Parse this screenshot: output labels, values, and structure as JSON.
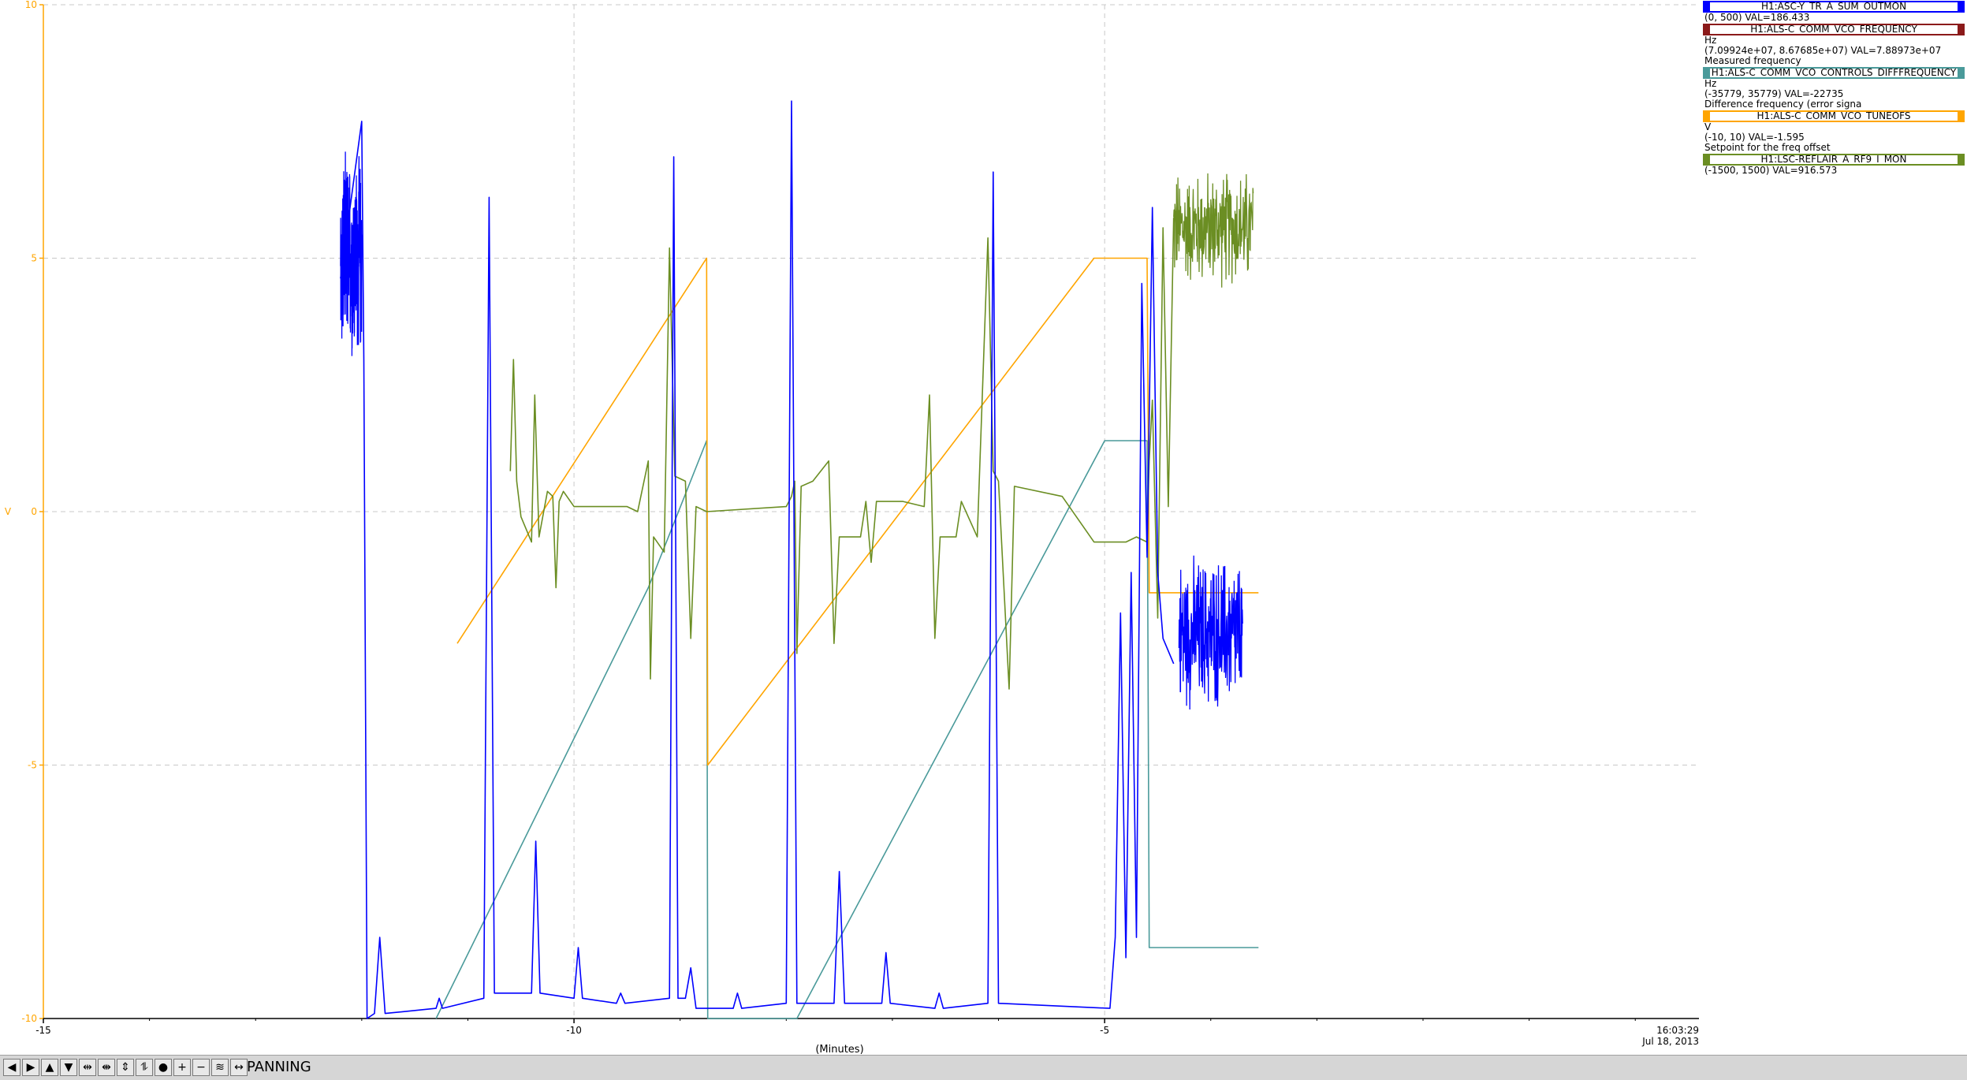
{
  "chart_data": {
    "type": "line",
    "xlabel": "(Minutes)",
    "ylabel": "V",
    "xlim": [
      -15,
      0.6
    ],
    "ylim": [
      -10,
      10
    ],
    "x_ticks": [
      -15,
      -10,
      -5
    ],
    "y_ticks": [
      10,
      5,
      0,
      -5,
      -10
    ],
    "grid": true,
    "timestamp_time": "16:03:29",
    "timestamp_date": "Jul 18, 2013",
    "legend_position": "right",
    "series": [
      {
        "name": "H1:ASC-Y_TR_A_SUM_OUTMON",
        "range": "(0, 500)",
        "value_text": "VAL=186.433",
        "color": "#0000ff",
        "noisy_segments": [
          {
            "x": [
              -12.2,
              -12.0
            ],
            "center": 5.0,
            "amp": 2.2
          },
          {
            "x": [
              -4.3,
              -3.7
            ],
            "center": -2.4,
            "amp": 1.7
          }
        ],
        "points": [
          [
            -12.2,
            4.6
          ],
          [
            -12.0,
            7.7
          ],
          [
            -11.98,
            3.0
          ],
          [
            -11.95,
            -10.0
          ],
          [
            -11.88,
            -9.9
          ],
          [
            -11.83,
            -8.4
          ],
          [
            -11.78,
            -9.9
          ],
          [
            -11.3,
            -9.8
          ],
          [
            -11.27,
            -9.6
          ],
          [
            -11.24,
            -9.8
          ],
          [
            -10.85,
            -9.6
          ],
          [
            -10.8,
            6.2
          ],
          [
            -10.75,
            -9.5
          ],
          [
            -10.4,
            -9.5
          ],
          [
            -10.36,
            -6.5
          ],
          [
            -10.32,
            -9.5
          ],
          [
            -10.0,
            -9.6
          ],
          [
            -9.96,
            -8.6
          ],
          [
            -9.92,
            -9.6
          ],
          [
            -9.6,
            -9.7
          ],
          [
            -9.56,
            -9.5
          ],
          [
            -9.52,
            -9.7
          ],
          [
            -9.1,
            -9.6
          ],
          [
            -9.06,
            7.0
          ],
          [
            -9.02,
            -9.6
          ],
          [
            -8.95,
            -9.6
          ],
          [
            -8.9,
            -9.0
          ],
          [
            -8.85,
            -9.8
          ],
          [
            -8.5,
            -9.8
          ],
          [
            -8.46,
            -9.5
          ],
          [
            -8.42,
            -9.8
          ],
          [
            -8.0,
            -9.7
          ],
          [
            -7.95,
            8.1
          ],
          [
            -7.9,
            -9.7
          ],
          [
            -7.55,
            -9.7
          ],
          [
            -7.5,
            -7.1
          ],
          [
            -7.45,
            -9.7
          ],
          [
            -7.1,
            -9.7
          ],
          [
            -7.06,
            -8.7
          ],
          [
            -7.02,
            -9.7
          ],
          [
            -6.6,
            -9.8
          ],
          [
            -6.56,
            -9.5
          ],
          [
            -6.52,
            -9.8
          ],
          [
            -6.1,
            -9.7
          ],
          [
            -6.05,
            6.7
          ],
          [
            -6.0,
            -9.7
          ],
          [
            -4.95,
            -9.8
          ],
          [
            -4.9,
            -8.4
          ],
          [
            -4.85,
            -2.0
          ],
          [
            -4.8,
            -8.8
          ],
          [
            -4.75,
            -1.2
          ],
          [
            -4.7,
            -8.4
          ],
          [
            -4.65,
            4.5
          ],
          [
            -4.6,
            -0.9
          ],
          [
            -4.55,
            6.0
          ],
          [
            -4.5,
            -1.2
          ],
          [
            -4.45,
            -2.5
          ],
          [
            -4.35,
            -3.0
          ]
        ]
      },
      {
        "name": "H1:ALS-C_COMM_VCO_FREQUENCY",
        "unit": "Hz",
        "range": "(7.09924e+07, 8.67685e+07)",
        "value_text": "VAL=7.88973e+07",
        "description": "Measured frequency",
        "color": "#8b1a1a",
        "points": []
      },
      {
        "name": "H1:ALS-C_COMM_VCO_CONTROLS_DIFFFREQUENCY",
        "unit": "Hz",
        "range": "(-35779, 35779)",
        "value_text": "VAL=-22735",
        "description": "Difference frequency (error signa",
        "color": "#4a9a9a",
        "points": [
          [
            -11.3,
            -10.0
          ],
          [
            -9.3,
            -1.5
          ],
          [
            -8.75,
            1.4
          ],
          [
            -8.74,
            -10.0
          ],
          [
            -7.9,
            -10.0
          ],
          [
            -5.0,
            1.4
          ],
          [
            -4.6,
            1.4
          ],
          [
            -4.58,
            -8.6
          ],
          [
            -4.5,
            -8.6
          ],
          [
            -4.4,
            -8.6
          ],
          [
            -3.55,
            -8.6
          ]
        ]
      },
      {
        "name": "H1:ALS-C_COMM_VCO_TUNEOFS",
        "unit": "V",
        "range": "(-10, 10)",
        "value_text": "VAL=-1.595",
        "description": "Setpoint for the freq offset",
        "color": "#ffa500",
        "points": [
          [
            -11.1,
            -2.6
          ],
          [
            -8.75,
            5.0
          ],
          [
            -8.74,
            -5.0
          ],
          [
            -5.1,
            5.0
          ],
          [
            -4.6,
            5.0
          ],
          [
            -4.58,
            -1.6
          ],
          [
            -3.55,
            -1.6
          ]
        ]
      },
      {
        "name": "H1:LSC-REFLAIR_A_RF9_I_MON",
        "range": "(-1500, 1500)",
        "value_text": "VAL=916.573",
        "color": "#6b8e23",
        "noisy_segments": [
          {
            "x": [
              -4.35,
              -3.6
            ],
            "center": 5.6,
            "amp": 1.3
          }
        ],
        "points": [
          [
            -10.6,
            0.8
          ],
          [
            -10.57,
            3.0
          ],
          [
            -10.54,
            0.6
          ],
          [
            -10.5,
            -0.1
          ],
          [
            -10.4,
            -0.6
          ],
          [
            -10.37,
            2.3
          ],
          [
            -10.33,
            -0.5
          ],
          [
            -10.25,
            0.4
          ],
          [
            -10.2,
            0.3
          ],
          [
            -10.17,
            -1.5
          ],
          [
            -10.14,
            0.2
          ],
          [
            -10.1,
            0.4
          ],
          [
            -10.0,
            0.1
          ],
          [
            -9.5,
            0.1
          ],
          [
            -9.4,
            0.0
          ],
          [
            -9.3,
            1.0
          ],
          [
            -9.28,
            -3.3
          ],
          [
            -9.25,
            -0.5
          ],
          [
            -9.15,
            -0.8
          ],
          [
            -9.1,
            5.2
          ],
          [
            -9.05,
            0.7
          ],
          [
            -8.95,
            0.6
          ],
          [
            -8.9,
            -2.5
          ],
          [
            -8.85,
            0.1
          ],
          [
            -8.75,
            0.0
          ],
          [
            -8.0,
            0.1
          ],
          [
            -7.95,
            0.3
          ],
          [
            -7.92,
            0.6
          ],
          [
            -7.9,
            -2.8
          ],
          [
            -7.86,
            0.5
          ],
          [
            -7.75,
            0.6
          ],
          [
            -7.6,
            1.0
          ],
          [
            -7.55,
            -2.6
          ],
          [
            -7.5,
            -0.5
          ],
          [
            -7.3,
            -0.5
          ],
          [
            -7.25,
            0.2
          ],
          [
            -7.2,
            -1.0
          ],
          [
            -7.15,
            0.2
          ],
          [
            -6.9,
            0.2
          ],
          [
            -6.7,
            0.1
          ],
          [
            -6.65,
            2.3
          ],
          [
            -6.6,
            -2.5
          ],
          [
            -6.55,
            -0.5
          ],
          [
            -6.4,
            -0.5
          ],
          [
            -6.35,
            0.2
          ],
          [
            -6.2,
            -0.5
          ],
          [
            -6.1,
            5.4
          ],
          [
            -6.05,
            0.8
          ],
          [
            -6.0,
            0.6
          ],
          [
            -5.9,
            -3.5
          ],
          [
            -5.85,
            0.5
          ],
          [
            -5.4,
            0.3
          ],
          [
            -5.1,
            -0.6
          ],
          [
            -5.0,
            -0.6
          ],
          [
            -4.8,
            -0.6
          ],
          [
            -4.7,
            -0.5
          ],
          [
            -4.6,
            -0.6
          ],
          [
            -4.58,
            1.0
          ],
          [
            -4.55,
            2.2
          ],
          [
            -4.5,
            -2.1
          ],
          [
            -4.45,
            5.6
          ],
          [
            -4.4,
            0.1
          ],
          [
            -4.35,
            5.8
          ]
        ]
      }
    ]
  },
  "toolbar": {
    "mode_label": "PANNING",
    "buttons": [
      {
        "id": "pan-left",
        "glyph": "◀",
        "icon": "arrow-left-icon"
      },
      {
        "id": "pan-right",
        "glyph": "▶",
        "icon": "arrow-right-icon"
      },
      {
        "id": "pan-up",
        "glyph": "▲",
        "icon": "arrow-up-icon"
      },
      {
        "id": "pan-down",
        "glyph": "▼",
        "icon": "arrow-down-icon"
      },
      {
        "id": "expand-x",
        "glyph": "⇹",
        "icon": "expand-horizontal-icon"
      },
      {
        "id": "shrink-x",
        "glyph": "⇼",
        "icon": "shrink-horizontal-icon"
      },
      {
        "id": "expand-y",
        "glyph": "⇕",
        "icon": "expand-vertical-icon"
      },
      {
        "id": "shrink-y",
        "glyph": "⥮",
        "icon": "shrink-vertical-icon"
      },
      {
        "id": "reset",
        "glyph": "●",
        "icon": "reset-icon"
      },
      {
        "id": "zoom-in",
        "glyph": "+",
        "icon": "zoom-in-icon"
      },
      {
        "id": "zoom-out",
        "glyph": "−",
        "icon": "zoom-out-icon"
      },
      {
        "id": "autoscale",
        "glyph": "≋",
        "icon": "autoscale-icon"
      },
      {
        "id": "pan-mode",
        "glyph": "↔",
        "icon": "pan-mode-icon"
      }
    ]
  }
}
